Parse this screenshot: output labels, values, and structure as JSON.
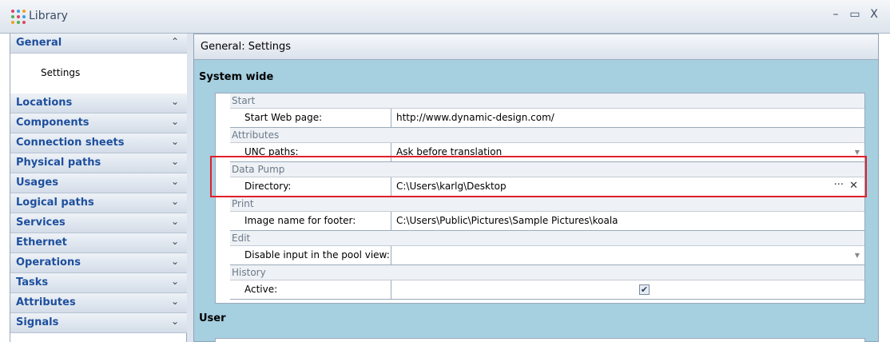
{
  "window": {
    "title": "Library",
    "controls": [
      "–",
      "▭",
      "X"
    ]
  },
  "sidebar": {
    "expanded": {
      "label": "General",
      "chevron": "⌃",
      "items": [
        "Settings"
      ]
    },
    "groups": [
      "Locations",
      "Components",
      "Connection sheets",
      "Physical paths",
      "Usages",
      "Logical paths",
      "Services",
      "Ethernet",
      "Operations",
      "Tasks",
      "Attributes",
      "Signals"
    ],
    "chevron": "⌄"
  },
  "panel": {
    "header": "General: Settings",
    "section_system": "System wide",
    "section_user": "User"
  },
  "properties": {
    "start": {
      "category": "Start",
      "name": "Start Web page:",
      "value": "http://www.dynamic-design.com/"
    },
    "attributes": {
      "category": "Attributes",
      "name": "UNC paths:",
      "value": "Ask before translation"
    },
    "datapump": {
      "category": "Data Pump",
      "name": "Directory:",
      "value": "C:\\Users\\karlg\\Desktop"
    },
    "print": {
      "category": "Print",
      "name": "Image name for footer:",
      "value": "C:\\Users\\Public\\Pictures\\Sample Pictures\\koala"
    },
    "edit": {
      "category": "Edit",
      "name": "Disable input in the pool view:",
      "value": ""
    },
    "history": {
      "category": "History",
      "name": "Active:",
      "checked": true
    }
  },
  "colors": {
    "accent_text": "#1d4f9e",
    "panel_bg": "#a6cfe0",
    "highlight": "#e0202a"
  }
}
